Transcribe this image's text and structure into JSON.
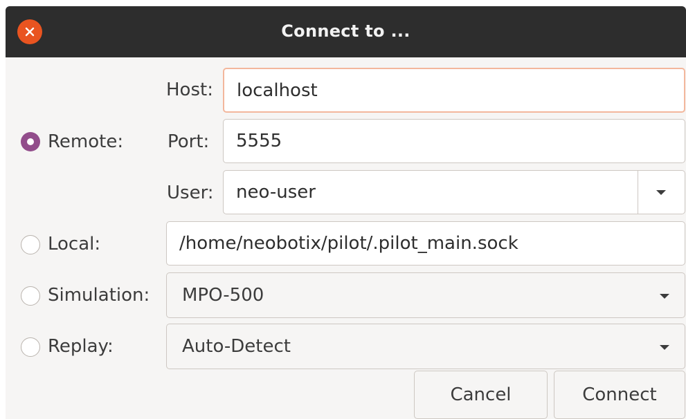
{
  "window": {
    "title": "Connect to ...",
    "close_icon": "close-icon",
    "accent": "#e95420"
  },
  "remote": {
    "label": "Remote:",
    "selected": true,
    "host_label": "Host:",
    "host_value": "localhost",
    "port_label": "Port:",
    "port_value": "5555",
    "user_label": "User:",
    "user_value": "neo-user"
  },
  "local": {
    "label": "Local:",
    "selected": false,
    "path_value": "/home/neobotix/pilot/.pilot_main.sock"
  },
  "simulation": {
    "label": "Simulation:",
    "selected": false,
    "value": "MPO-500"
  },
  "replay": {
    "label": "Replay:",
    "selected": false,
    "value": "Auto-Detect"
  },
  "buttons": {
    "cancel": "Cancel",
    "connect": "Connect"
  },
  "colors": {
    "radio_selected": "#924d8b",
    "focus_border": "#f3b79c",
    "titlebar": "#2d2d2d"
  }
}
